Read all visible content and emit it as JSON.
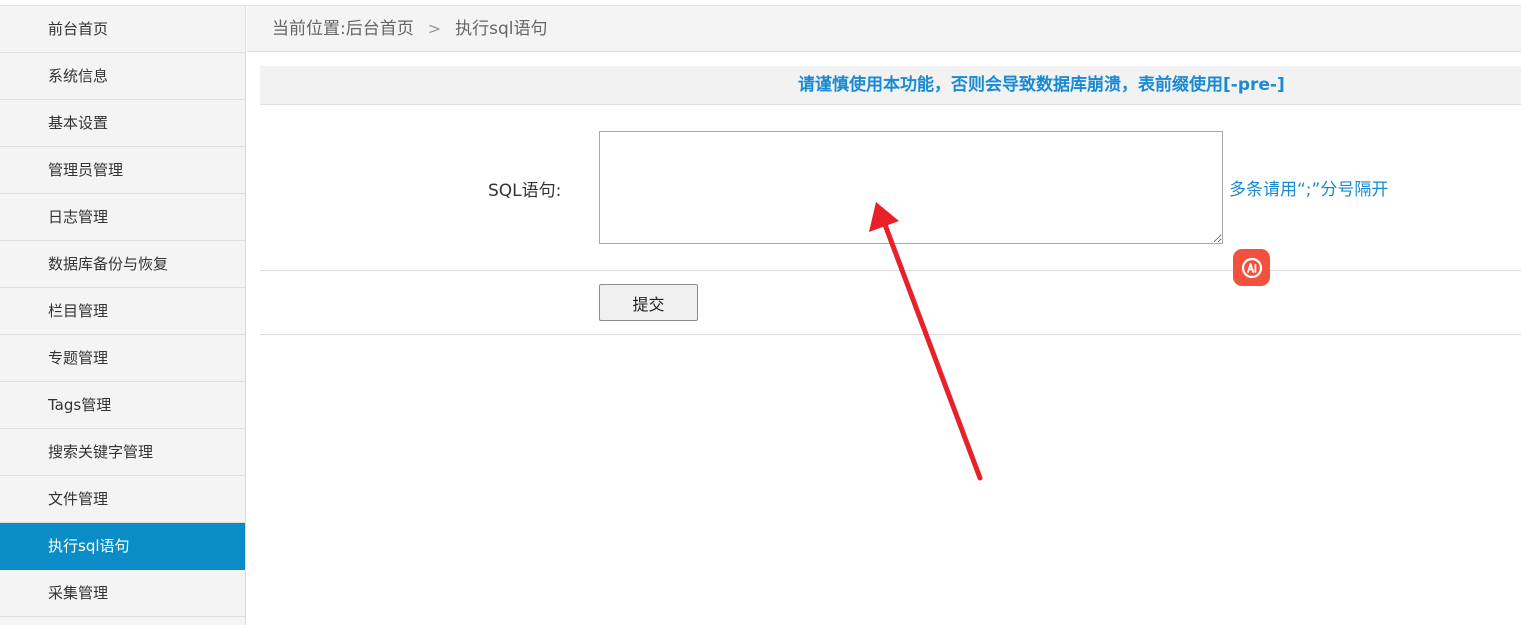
{
  "sidebar": {
    "items": [
      {
        "label": "前台首页",
        "active": false
      },
      {
        "label": "系统信息",
        "active": false
      },
      {
        "label": "基本设置",
        "active": false
      },
      {
        "label": "管理员管理",
        "active": false
      },
      {
        "label": "日志管理",
        "active": false
      },
      {
        "label": "数据库备份与恢复",
        "active": false
      },
      {
        "label": "栏目管理",
        "active": false
      },
      {
        "label": "专题管理",
        "active": false
      },
      {
        "label": "Tags管理",
        "active": false
      },
      {
        "label": "搜索关键字管理",
        "active": false
      },
      {
        "label": "文件管理",
        "active": false
      },
      {
        "label": "执行sql语句",
        "active": true
      },
      {
        "label": "采集管理",
        "active": false
      }
    ]
  },
  "breadcrumb": {
    "prefix": "当前位置:",
    "home": "后台首页",
    "separator": ">",
    "current": "执行sql语句"
  },
  "notice": {
    "text": "请谨慎使用本功能，否则会导致数据库崩溃，表前缀使用[-pre-]"
  },
  "form": {
    "sql_label": "SQL语句:",
    "sql_value": "",
    "sql_hint": "多条请用“;”分号隔开",
    "submit_label": "提交"
  },
  "colors": {
    "accent": "#0a8dc7",
    "link": "#1a8ad3",
    "annotation_arrow": "#e8202a",
    "ai_badge": "#f2513d"
  },
  "icons": {
    "ai_badge": "ai-assistant-icon",
    "annotation": "red-arrow-annotation"
  }
}
